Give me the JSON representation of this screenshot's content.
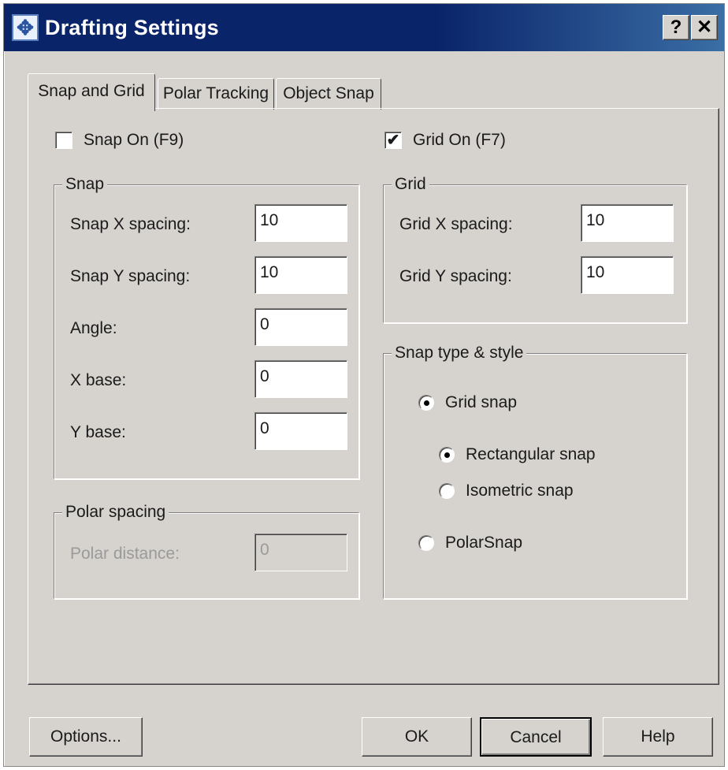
{
  "window": {
    "title": "Drafting Settings",
    "icon": "drafting-settings-icon",
    "help_label": "?",
    "close_label": "✕"
  },
  "tabs": [
    {
      "label": "Snap and Grid",
      "active": true
    },
    {
      "label": "Polar Tracking",
      "active": false
    },
    {
      "label": "Object Snap",
      "active": false
    }
  ],
  "snap_on": {
    "label": "Snap On (F9)",
    "checked": false
  },
  "grid_on": {
    "label": "Grid On (F7)",
    "checked": true,
    "mark": "✔"
  },
  "snap_group": {
    "title": "Snap",
    "fields": [
      {
        "label": "Snap X spacing:",
        "value": "10"
      },
      {
        "label": "Snap Y spacing:",
        "value": "10"
      },
      {
        "label": "Angle:",
        "value": "0"
      },
      {
        "label": "X base:",
        "value": "0"
      },
      {
        "label": "Y base:",
        "value": "0"
      }
    ]
  },
  "polar_group": {
    "title": "Polar spacing",
    "field": {
      "label": "Polar distance:",
      "value": "0",
      "enabled": false
    }
  },
  "grid_group": {
    "title": "Grid",
    "fields": [
      {
        "label": "Grid X spacing:",
        "value": "10"
      },
      {
        "label": "Grid Y spacing:",
        "value": "10"
      }
    ]
  },
  "snap_type_group": {
    "title": "Snap type & style",
    "options": [
      {
        "label": "Grid snap",
        "selected": true
      },
      {
        "label": "Rectangular snap",
        "selected": true
      },
      {
        "label": "Isometric snap",
        "selected": false
      },
      {
        "label": "PolarSnap",
        "selected": false
      }
    ]
  },
  "buttons": {
    "options": "Options...",
    "ok": "OK",
    "cancel": "Cancel",
    "help": "Help"
  },
  "colors": {
    "titlebar": "#0a246a",
    "face": "#d6d3ce",
    "disabled_text": "#9a9a9a"
  }
}
